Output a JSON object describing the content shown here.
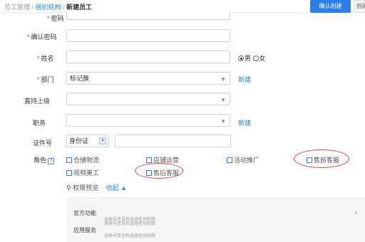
{
  "breadcrumb": {
    "root": "员工管理",
    "sep1": "/",
    "section": "组织结构",
    "sep2": "/",
    "current": "新建员工"
  },
  "actions": {
    "confirm_label": "确认创建",
    "secondary_label": "创建"
  },
  "form": {
    "password_label": "密码",
    "confirm_password_label": "确认密码",
    "name_label": "姓名",
    "gender": {
      "male": "男",
      "female": "女",
      "selected": "男"
    },
    "department_label": "部门",
    "department_value": "标记簇",
    "department_new": "新建",
    "supervisor_label": "直持上级",
    "position_label": "职务",
    "position_new": "新建",
    "id_label": "证件号",
    "id_type": "身份证",
    "roles_label": "角色",
    "roles": [
      "仓储物流",
      "店铺运营",
      "活动推广",
      "售前客服",
      "视频美工",
      "售后客服"
    ],
    "permission_preview": "权限预览",
    "collapse": "收起"
  },
  "panel": {
    "items": [
      {
        "title": "官方功能",
        "note": "该账号还没有选择任何权限"
      },
      {
        "title": "应用服务",
        "note": "该账号还没有选择任何权限"
      },
      {
        "title": "",
        "note": "该账号还没有选择任何权限"
      }
    ]
  },
  "icons": {
    "search": "search-icon",
    "help": "help-icon",
    "chevron_up": "chevron-up-icon",
    "chevron_down": "chevron-down-icon"
  },
  "colors": {
    "accent": "#2d7ee9",
    "link": "#1e88e5",
    "required": "#e53935",
    "annotation": "#d9453c"
  }
}
